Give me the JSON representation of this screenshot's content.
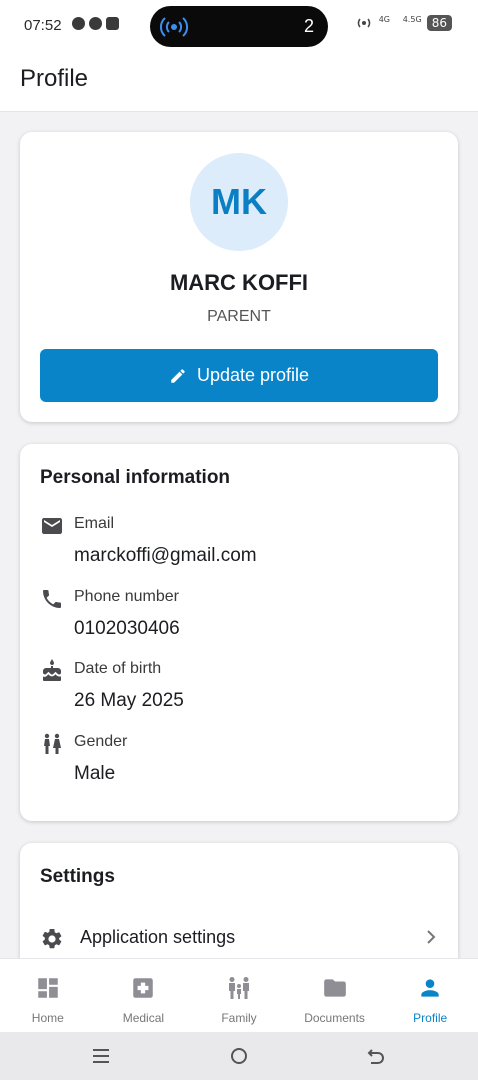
{
  "status_bar": {
    "time": "07:52",
    "notification_count": "2",
    "network_1": "4G",
    "network_2": "4.5G",
    "battery": "86"
  },
  "app_bar": {
    "title": "Profile"
  },
  "profile": {
    "initials": "MK",
    "name": "MARC KOFFI",
    "role": "PARENT",
    "update_button_label": "Update profile"
  },
  "personal_info": {
    "title": "Personal information",
    "fields": [
      {
        "label": "Email",
        "value": "marckoffi@gmail.com",
        "icon": "mail-icon"
      },
      {
        "label": "Phone number",
        "value": "0102030406",
        "icon": "phone-icon"
      },
      {
        "label": "Date of birth",
        "value": "26 May 2025",
        "icon": "cake-icon"
      },
      {
        "label": "Gender",
        "value": "Male",
        "icon": "gender-icon"
      }
    ]
  },
  "settings": {
    "title": "Settings",
    "items": [
      {
        "label": "Application settings",
        "icon": "gear-icon"
      }
    ]
  },
  "bottom_nav": {
    "items": [
      {
        "label": "Home",
        "icon": "dashboard-icon"
      },
      {
        "label": "Medical",
        "icon": "medical-cross-icon"
      },
      {
        "label": "Family",
        "icon": "family-icon"
      },
      {
        "label": "Documents",
        "icon": "folder-icon"
      },
      {
        "label": "Profile",
        "icon": "person-icon",
        "active": true
      }
    ]
  },
  "colors": {
    "accent": "#0a84c9",
    "avatar_bg": "#dcecfa",
    "avatar_text": "#0a7fc3"
  }
}
